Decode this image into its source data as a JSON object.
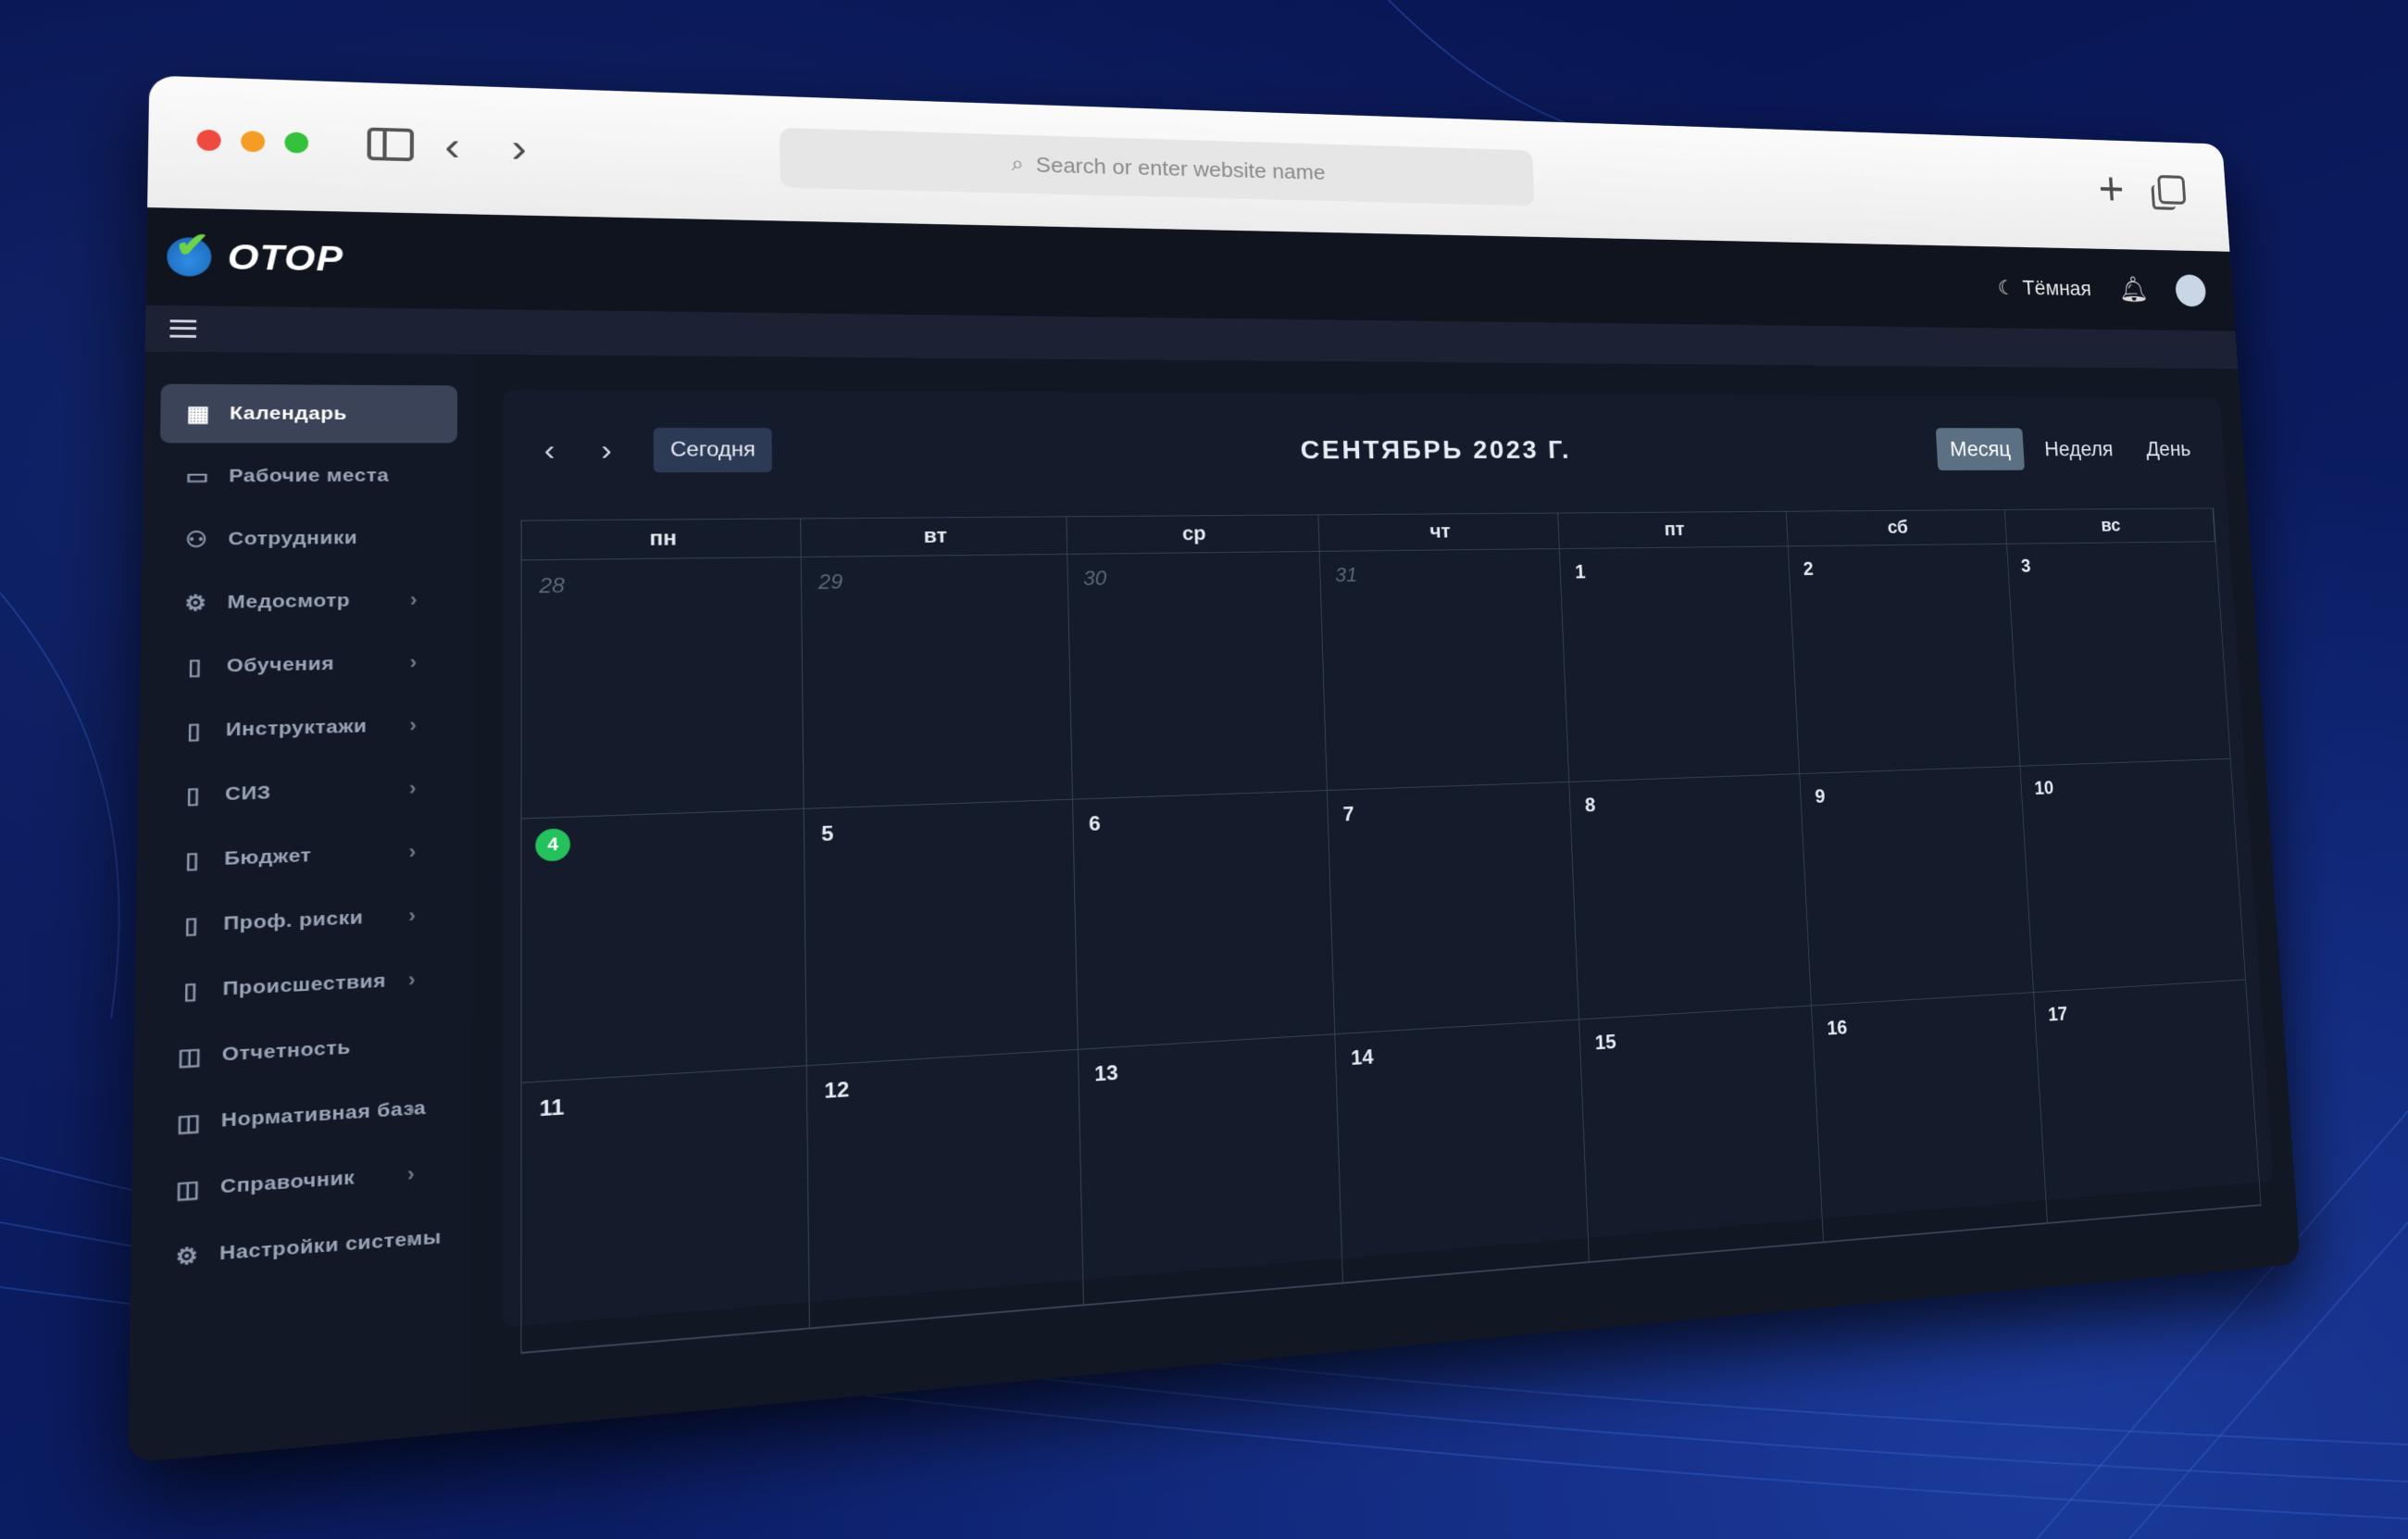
{
  "browser": {
    "url_placeholder": "Search or enter website name"
  },
  "app": {
    "logo_text": "OTOP",
    "theme_label": "Тёмная"
  },
  "sidebar": {
    "items": [
      {
        "label": "Календарь",
        "icon": "calendar-icon",
        "active": true
      },
      {
        "label": "Рабочие места",
        "icon": "workplace-icon"
      },
      {
        "label": "Сотрудники",
        "icon": "users-icon"
      },
      {
        "label": "Медосмотр",
        "icon": "gear-icon",
        "has_children": true
      },
      {
        "label": "Обучения",
        "icon": "book-icon",
        "has_children": true
      },
      {
        "label": "Инструктажи",
        "icon": "clipboard-icon",
        "has_children": true
      },
      {
        "label": "СИЗ",
        "icon": "clipboard-icon",
        "has_children": true
      },
      {
        "label": "Бюджет",
        "icon": "clipboard-icon",
        "has_children": true
      },
      {
        "label": "Проф. риски",
        "icon": "clipboard-icon",
        "has_children": true
      },
      {
        "label": "Происшествия",
        "icon": "clipboard-icon",
        "has_children": true
      },
      {
        "label": "Отчетность",
        "icon": "database-icon"
      },
      {
        "label": "Нормативная база",
        "icon": "database-icon",
        "has_children": true
      },
      {
        "label": "Справочник",
        "icon": "database-icon",
        "has_children": true
      },
      {
        "label": "Настройки системы",
        "icon": "gear-icon",
        "has_children": true
      }
    ]
  },
  "calendar": {
    "today_label": "Сегодня",
    "title": "СЕНТЯБРЬ 2023 Г.",
    "views": [
      {
        "label": "Месяц",
        "active": true
      },
      {
        "label": "Неделя"
      },
      {
        "label": "День"
      }
    ],
    "weekdays": [
      "пн",
      "вт",
      "ср",
      "чт",
      "пт",
      "сб",
      "вс"
    ],
    "weeks": [
      [
        {
          "n": "28",
          "other": true
        },
        {
          "n": "29",
          "other": true
        },
        {
          "n": "30",
          "other": true
        },
        {
          "n": "31",
          "other": true
        },
        {
          "n": "1"
        },
        {
          "n": "2"
        },
        {
          "n": "3"
        }
      ],
      [
        {
          "n": "4",
          "today": true
        },
        {
          "n": "5"
        },
        {
          "n": "6"
        },
        {
          "n": "7"
        },
        {
          "n": "8"
        },
        {
          "n": "9"
        },
        {
          "n": "10"
        }
      ],
      [
        {
          "n": "11"
        },
        {
          "n": "12"
        },
        {
          "n": "13"
        },
        {
          "n": "14"
        },
        {
          "n": "15"
        },
        {
          "n": "16"
        },
        {
          "n": "17"
        }
      ]
    ]
  }
}
